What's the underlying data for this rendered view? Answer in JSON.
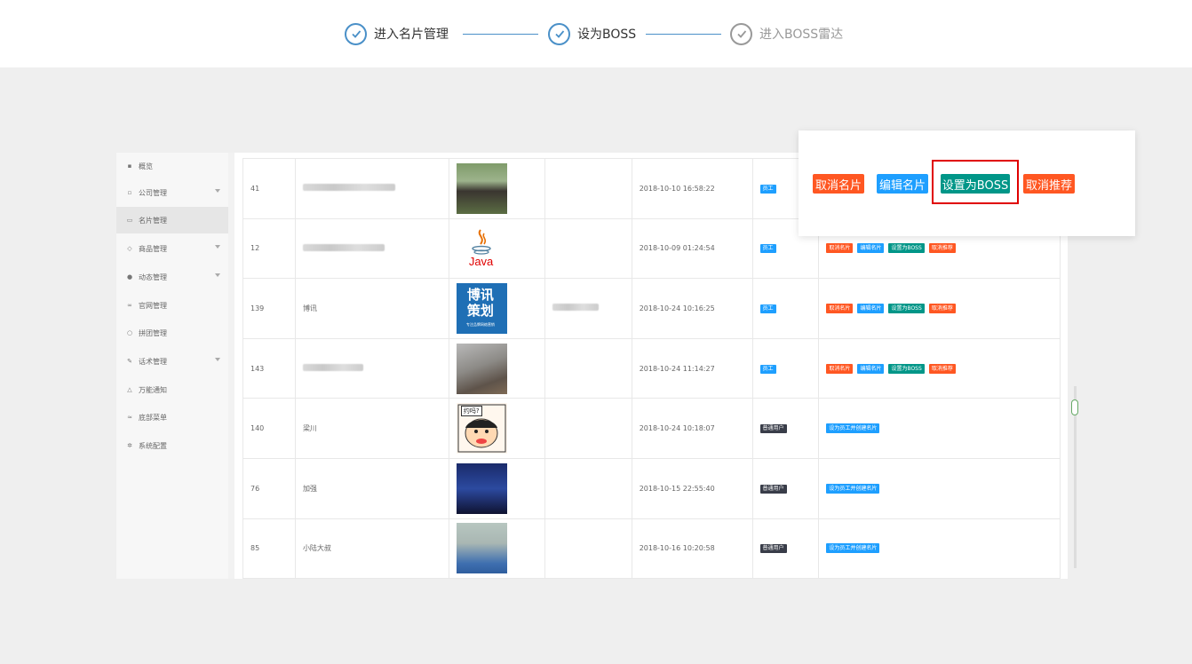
{
  "steps": [
    {
      "label": "进入名片管理",
      "state": "done"
    },
    {
      "label": "设为BOSS",
      "state": "done"
    },
    {
      "label": "进入BOSS雷达",
      "state": "pending"
    }
  ],
  "sidebar": {
    "items": [
      {
        "label": "概览",
        "icon": "chat-icon",
        "has_caret": false
      },
      {
        "label": "公司管理",
        "icon": "building-icon",
        "has_caret": true
      },
      {
        "label": "名片管理",
        "icon": "card-icon",
        "has_caret": false,
        "active": true
      },
      {
        "label": "商品管理",
        "icon": "box-icon",
        "has_caret": true
      },
      {
        "label": "动态管理",
        "icon": "compass-icon",
        "has_caret": true
      },
      {
        "label": "官网管理",
        "icon": "link-icon",
        "has_caret": false
      },
      {
        "label": "拼团管理",
        "icon": "circle-icon",
        "has_caret": false
      },
      {
        "label": "话术管理",
        "icon": "pen-icon",
        "has_caret": true
      },
      {
        "label": "万能通知",
        "icon": "bell-icon",
        "has_caret": false
      },
      {
        "label": "底部菜单",
        "icon": "menu-icon",
        "has_caret": false
      },
      {
        "label": "系统配置",
        "icon": "gear-icon",
        "has_caret": false
      }
    ]
  },
  "table": {
    "rows": [
      {
        "id": "41",
        "name": "",
        "image": "person-photo",
        "extra": "",
        "time": "2018-10-10 16:58:22",
        "role": "员工",
        "role_type": "staff",
        "actions": [
          "取消名片",
          "编辑名片",
          "设置为BOSS",
          "取消推荐"
        ]
      },
      {
        "id": "12",
        "name": "",
        "image": "java-logo",
        "extra": "",
        "time": "2018-10-09 01:24:54",
        "role": "员工",
        "role_type": "staff",
        "actions": [
          "取消名片",
          "编辑名片",
          "设置为BOSS",
          "取消推荐"
        ]
      },
      {
        "id": "139",
        "name": "博讯",
        "image": "boxun-logo",
        "extra": "",
        "time": "2018-10-24 10:16:25",
        "role": "员工",
        "role_type": "staff",
        "actions": [
          "取消名片",
          "编辑名片",
          "设置为BOSS",
          "取消推荐"
        ]
      },
      {
        "id": "143",
        "name": "",
        "image": "smoke-photo",
        "extra": "",
        "time": "2018-10-24 11:14:27",
        "role": "员工",
        "role_type": "staff",
        "actions": [
          "取消名片",
          "编辑名片",
          "设置为BOSS",
          "取消推荐"
        ]
      },
      {
        "id": "140",
        "name": "梁川",
        "image": "cartoon-avatar",
        "extra": "",
        "time": "2018-10-24 10:18:07",
        "role": "普通用户",
        "role_type": "user",
        "actions": [
          "设为员工并创建名片"
        ]
      },
      {
        "id": "76",
        "name": "加强",
        "image": "night-photo",
        "extra": "",
        "time": "2018-10-15 22:55:40",
        "role": "普通用户",
        "role_type": "user",
        "actions": [
          "设为员工并创建名片"
        ]
      },
      {
        "id": "85",
        "name": "小陆大叔",
        "image": "face-photo",
        "extra": "",
        "time": "2018-10-16 10:20:58",
        "role": "普通用户",
        "role_type": "user",
        "actions": [
          "设为员工并创建名片"
        ]
      }
    ]
  },
  "java_text": "Java",
  "boxun_text": [
    "博讯",
    "策划"
  ],
  "boxun_sub": "专注品牌网络营销",
  "cartoon_text": "约吗?",
  "popup": {
    "buttons": [
      {
        "label": "取消名片",
        "color": "#ff5722"
      },
      {
        "label": "编辑名片",
        "color": "#1e9fff"
      },
      {
        "label": "设置为BOSS",
        "color": "#009688"
      },
      {
        "label": "取消推荐",
        "color": "#ff5722"
      }
    ],
    "highlight_color": "#e00000"
  },
  "colors": {
    "accent_blue": "#4a90c8",
    "staff_tag": "#1e9fff",
    "user_tag": "#393d49"
  }
}
